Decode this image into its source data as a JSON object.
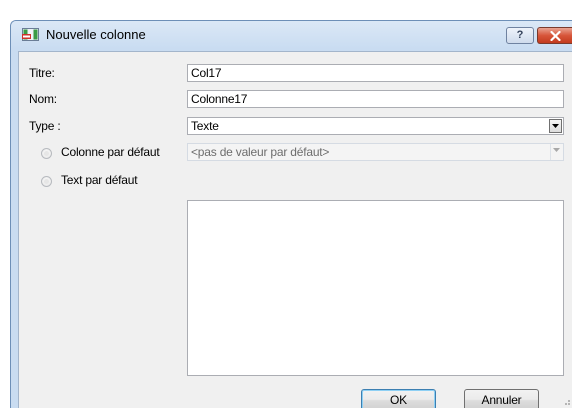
{
  "window": {
    "title": "Nouvelle colonne",
    "help_label": "?"
  },
  "form": {
    "titre_label": "Titre:",
    "titre_value": "Col17",
    "nom_label": "Nom:",
    "nom_value": "Colonne17",
    "type_label": "Type :",
    "type_value": "Texte",
    "default_column_label": "Colonne par défaut",
    "default_column_value": "<pas de valeur par défaut>",
    "default_text_label": "Text par défaut"
  },
  "buttons": {
    "ok": "OK",
    "cancel": "Annuler"
  },
  "colors": {
    "frame": "#c9dcf1",
    "close": "#c33b1e",
    "dialog_bg": "#f0f0f0"
  }
}
